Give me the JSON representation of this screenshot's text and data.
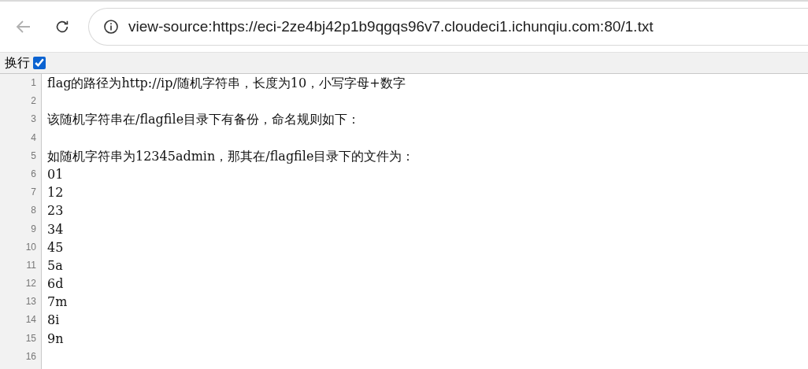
{
  "browser": {
    "address": "view-source:https://eci-2ze4bj42p1b9qgqs96v7.cloudeci1.ichunqiu.com:80/1.txt"
  },
  "wrap_toggle": {
    "label": "换行",
    "checked": true
  },
  "lines": [
    {
      "number": "1",
      "text": "flag的路径为http://ip/随机字符串，长度为10，小写字母+数字"
    },
    {
      "number": "2"
    },
    {
      "number": "3",
      "text": "该随机字符串在/flagfile目录下有备份，命名规则如下："
    },
    {
      "number": "4"
    },
    {
      "number": "5",
      "text": "如随机字符串为12345admin，那其在/flagfile目录下的文件为："
    },
    {
      "number": "6",
      "text": "01"
    },
    {
      "number": "7",
      "text": "12"
    },
    {
      "number": "8",
      "text": "23"
    },
    {
      "number": "9",
      "text": "34"
    },
    {
      "number": "10",
      "text": "45"
    },
    {
      "number": "11",
      "text": "5a"
    },
    {
      "number": "12",
      "text": "6d"
    },
    {
      "number": "13",
      "text": "7m"
    },
    {
      "number": "14",
      "text": "8i"
    },
    {
      "number": "15",
      "text": "9n"
    },
    {
      "number": "16"
    }
  ]
}
